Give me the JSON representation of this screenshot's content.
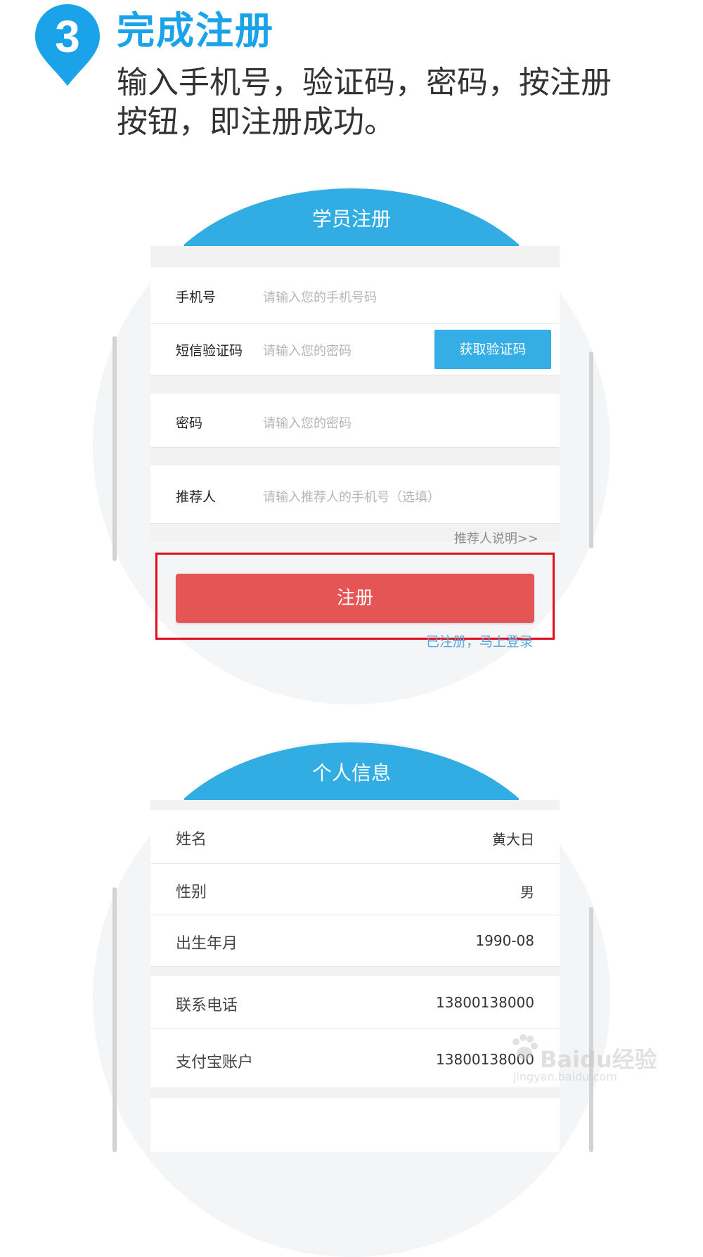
{
  "header": {
    "step_number": "3",
    "title": "完成注册",
    "description": "输入手机号，验证码，密码，按注册按钮，即注册成功。"
  },
  "register_form": {
    "title": "学员注册",
    "phone_label": "手机号",
    "phone_placeholder": "请输入您的手机号码",
    "sms_label": "短信验证码",
    "sms_placeholder": "请输入您的密码",
    "get_code_button": "获取验证码",
    "password_label": "密码",
    "password_placeholder": "请输入您的密码",
    "referrer_label": "推荐人",
    "referrer_placeholder": "请输入推荐人的手机号（选填）",
    "referrer_note": "推荐人说明>>",
    "register_button": "注册",
    "login_link": "已注册，马上登录"
  },
  "profile": {
    "title": "个人信息",
    "rows": [
      {
        "label": "姓名",
        "value": "黄大日"
      },
      {
        "label": "性别",
        "value": "男"
      },
      {
        "label": "出生年月",
        "value": "1990-08"
      },
      {
        "label": "联系电话",
        "value": "13800138000"
      },
      {
        "label": "支付宝账户",
        "value": "13800138000"
      }
    ]
  },
  "watermark": {
    "brand": "Baidu经验",
    "url": "jingyan.baidu.com"
  },
  "colors": {
    "accent_blue": "#1aa3e8",
    "arc_blue": "#31ade3",
    "register_red": "#e55555",
    "highlight_red": "#e00b1c"
  }
}
